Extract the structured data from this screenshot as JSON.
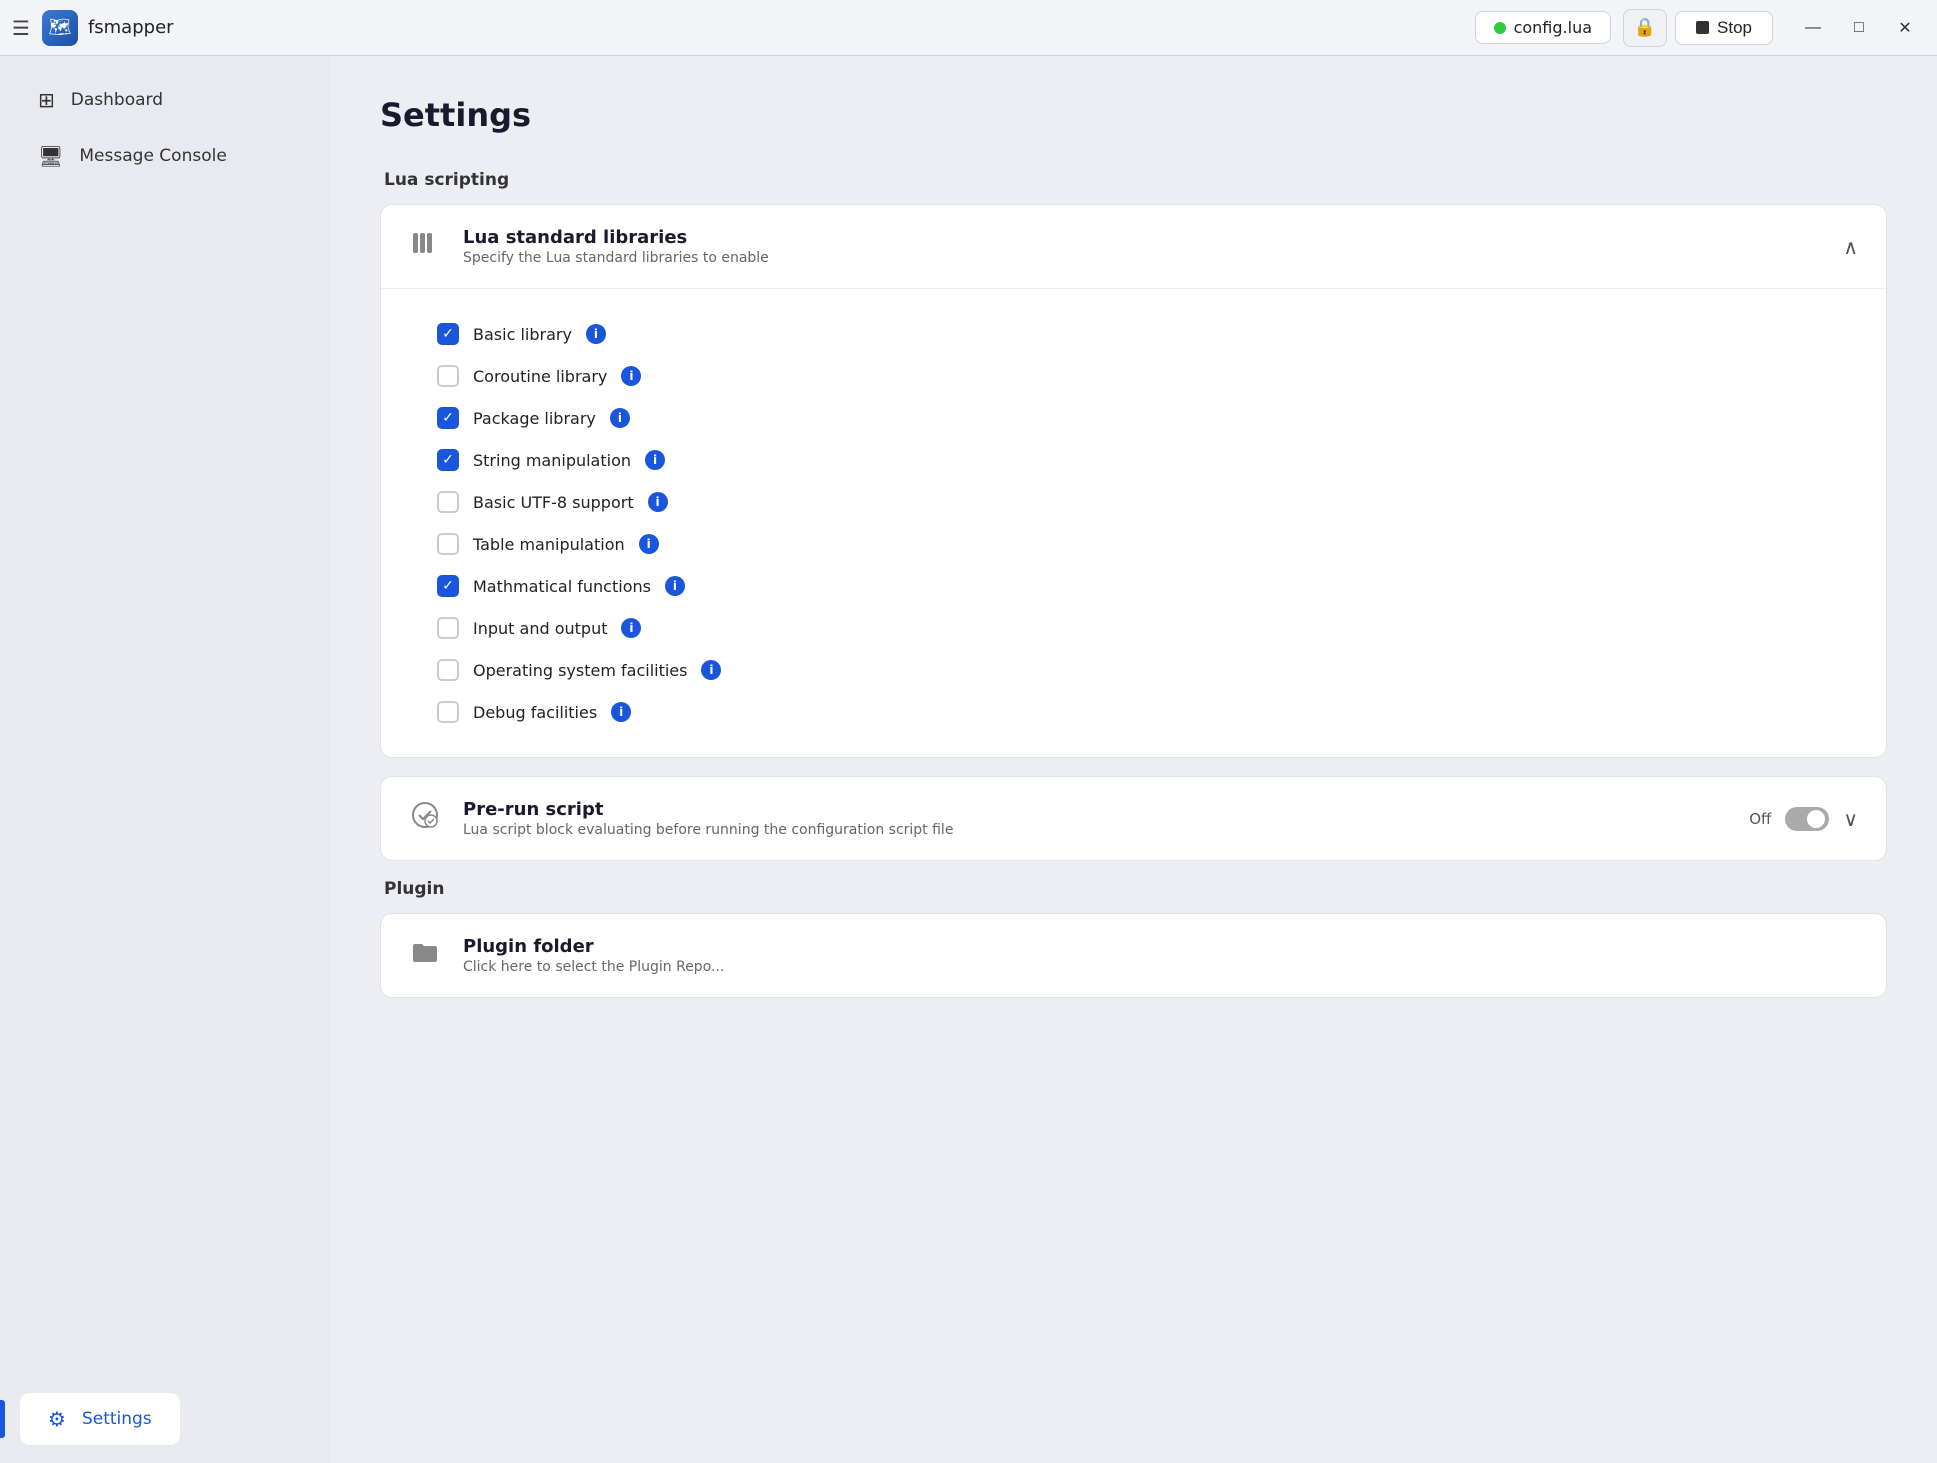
{
  "app": {
    "name": "fsmapper",
    "icon_char": "🗺"
  },
  "titlebar": {
    "menu_icon": "☰",
    "file_tab": {
      "name": "config.lua",
      "dot_color": "#2ecc40"
    },
    "stop_button_label": "Stop",
    "win_controls": {
      "minimize": "—",
      "maximize": "□",
      "close": "✕"
    }
  },
  "sidebar": {
    "items": [
      {
        "label": "Dashboard",
        "icon": "⊞",
        "active": false
      },
      {
        "label": "Message Console",
        "icon": "🖥",
        "active": false
      }
    ],
    "bottom_items": [
      {
        "label": "Settings",
        "icon": "⚙",
        "active": true
      }
    ]
  },
  "main": {
    "page_title": "Settings",
    "sections": [
      {
        "id": "lua-scripting",
        "label": "Lua scripting",
        "cards": [
          {
            "id": "lua-standard-libraries",
            "icon": "📚",
            "title": "Lua standard libraries",
            "subtitle": "Specify the Lua standard libraries to enable",
            "expanded": true,
            "chevron": "∧",
            "checkboxes": [
              {
                "id": "basic-library",
                "label": "Basic library",
                "checked": true
              },
              {
                "id": "coroutine-library",
                "label": "Coroutine library",
                "checked": false
              },
              {
                "id": "package-library",
                "label": "Package library",
                "checked": true
              },
              {
                "id": "string-manipulation",
                "label": "String manipulation",
                "checked": true
              },
              {
                "id": "basic-utf8-support",
                "label": "Basic UTF-8 support",
                "checked": false
              },
              {
                "id": "table-manipulation",
                "label": "Table manipulation",
                "checked": false
              },
              {
                "id": "mathematical-functions",
                "label": "Mathmatical functions",
                "checked": true
              },
              {
                "id": "input-and-output",
                "label": "Input and output",
                "checked": false
              },
              {
                "id": "operating-system-facilities",
                "label": "Operating system facilities",
                "checked": false
              },
              {
                "id": "debug-facilities",
                "label": "Debug facilities",
                "checked": false
              }
            ]
          },
          {
            "id": "pre-run-script",
            "icon": "⚙",
            "title": "Pre-run script",
            "subtitle": "Lua script block evaluating before running the configuration script file",
            "expanded": false,
            "chevron": "∨",
            "toggle": {
              "state": "Off",
              "enabled": false
            }
          }
        ]
      },
      {
        "id": "plugin",
        "label": "Plugin",
        "cards": [
          {
            "id": "plugin-folder",
            "icon": "📁",
            "title": "Plugin folder",
            "subtitle": "Click here to select the Plugin Repo...",
            "expanded": false,
            "chevron": ""
          }
        ]
      }
    ]
  }
}
